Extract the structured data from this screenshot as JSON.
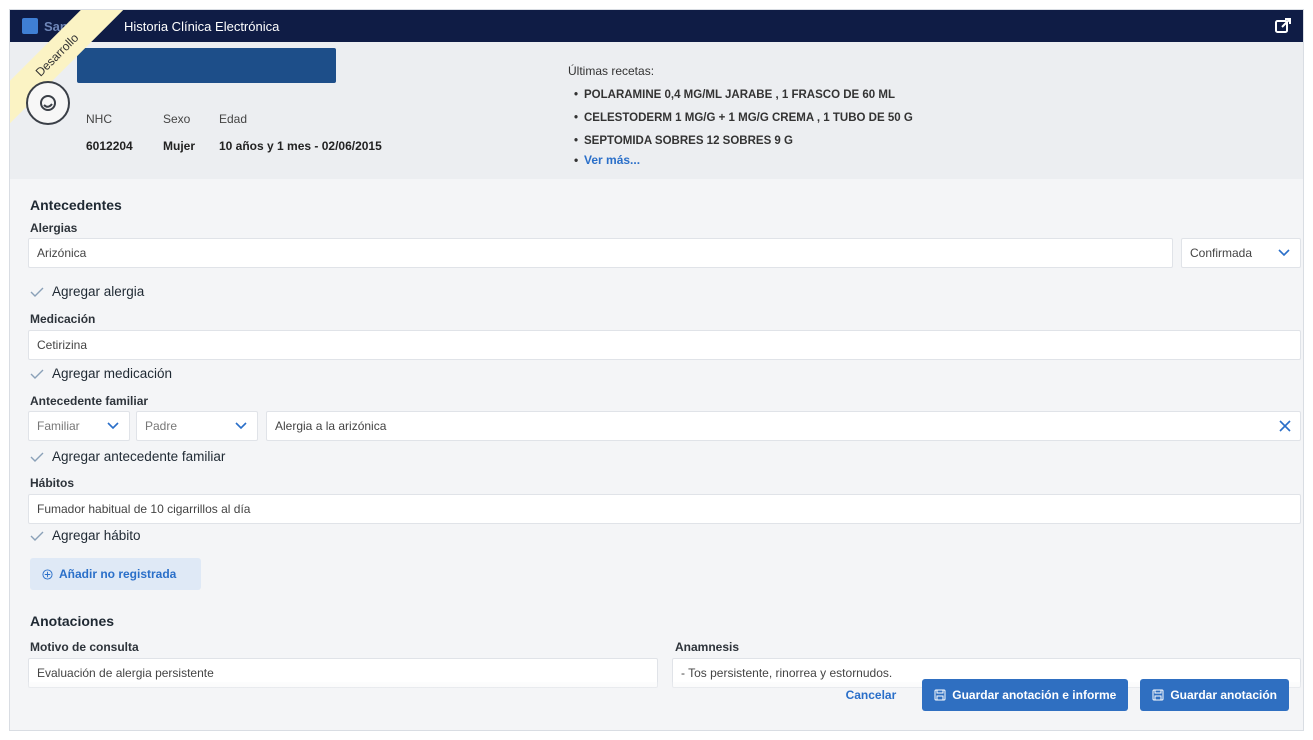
{
  "topbar": {
    "brand": "Sanitas",
    "title": "Historia Clínica Electrónica"
  },
  "ribbon": "Desarrollo",
  "patient": {
    "nhc_label": "NHC",
    "sexo_label": "Sexo",
    "edad_label": "Edad",
    "nhc": "6012204",
    "sexo": "Mujer",
    "edad": "10 años y 1 mes - 02/06/2015"
  },
  "recetas": {
    "title": "Últimas recetas:",
    "items": [
      "POLARAMINE 0,4 MG/ML JARABE , 1 FRASCO DE 60 ML",
      "CELESTODERM 1 MG/G + 1 MG/G CREMA , 1 TUBO DE 50 G",
      "SEPTOMIDA SOBRES 12 SOBRES 9 G"
    ],
    "more": "Ver más..."
  },
  "antecedentes": {
    "title": "Antecedentes",
    "alergias_label": "Alergias",
    "alergia_value": "Arizónica",
    "alergia_status": "Confirmada",
    "add_alergia": "Agregar alergia",
    "medicacion_label": "Medicación",
    "medicacion_value": "Cetirizina",
    "add_medicacion": "Agregar medicación",
    "familiar_label": "Antecedente familiar",
    "familiar_type": "Familiar",
    "familiar_relation": "Padre",
    "familiar_value": "Alergia a la arizónica",
    "add_familiar": "Agregar antecedente familiar",
    "habitos_label": "Hábitos",
    "habitos_value": "Fumador habitual de 10 cigarrillos al día",
    "add_habito": "Agregar hábito",
    "add_no_registrada": "Añadir no registrada"
  },
  "anotaciones": {
    "title": "Anotaciones",
    "motivo_label": "Motivo de consulta",
    "motivo_value": "Evaluación de alergia persistente",
    "anamnesis_label": "Anamnesis",
    "anamnesis_value": "- Tos persistente, rinorrea y estornudos."
  },
  "actions": {
    "cancel": "Cancelar",
    "save_report": "Guardar anotación e informe",
    "save": "Guardar anotación"
  },
  "colors": {
    "topbar": "#0f1c45",
    "accent": "#2f6fc1",
    "name_block": "#1d4e89"
  }
}
